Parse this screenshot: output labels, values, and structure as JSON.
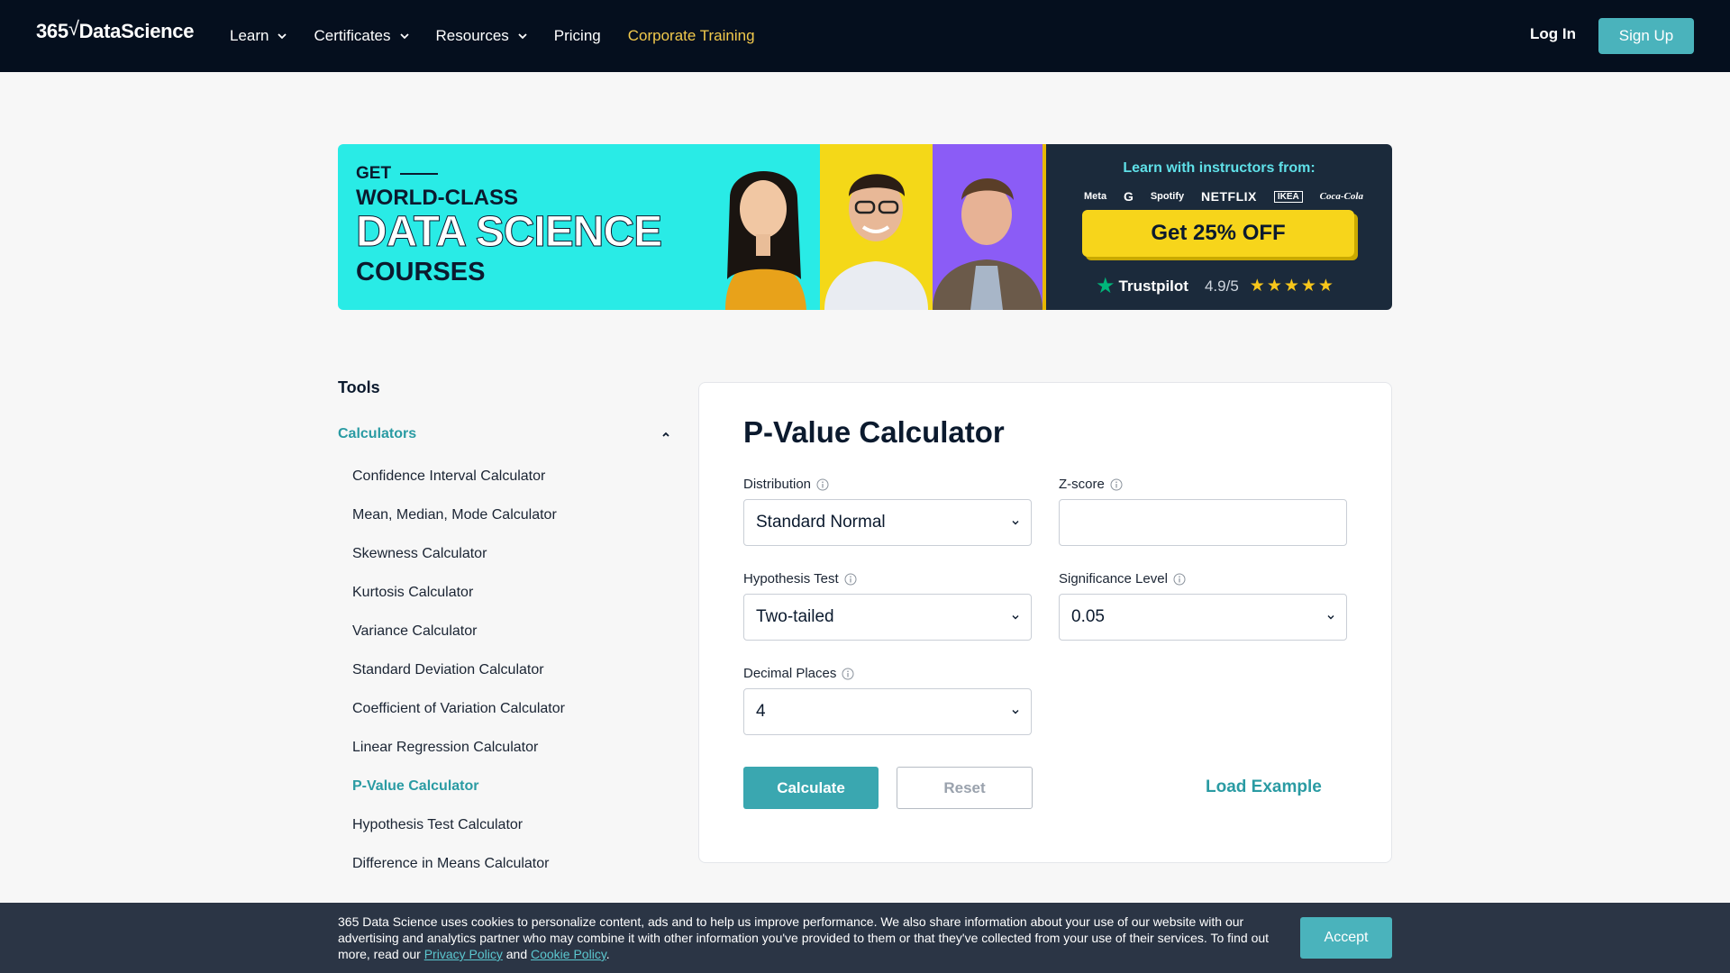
{
  "nav": {
    "logo_prefix": "365",
    "logo_check": "√",
    "logo_name": "DataScience",
    "items": [
      {
        "label": "Learn",
        "has_dropdown": true
      },
      {
        "label": "Certificates",
        "has_dropdown": true
      },
      {
        "label": "Resources",
        "has_dropdown": true
      },
      {
        "label": "Pricing",
        "has_dropdown": false
      },
      {
        "label": "Corporate Training",
        "has_dropdown": false,
        "color": "#f2c94c"
      }
    ],
    "login": "Log In",
    "signup": "Sign Up"
  },
  "banner": {
    "get": "GET",
    "world_class": "WORLD-CLASS",
    "data_science": "DATA SCIENCE",
    "courses": "COURSES",
    "learn_with": "Learn with instructors from:",
    "companies": [
      "Meta",
      "G",
      "Spotify",
      "NETFLIX",
      "IKEA",
      "Coca-Cola"
    ],
    "cta": "Get 25% OFF",
    "trustpilot": "Trustpilot",
    "rating": "4.9/5",
    "stars": 4.5
  },
  "sidebar": {
    "title": "Tools",
    "category": "Calculators",
    "items": [
      {
        "label": "Confidence Interval Calculator",
        "active": false
      },
      {
        "label": "Mean, Median, Mode Calculator",
        "active": false
      },
      {
        "label": "Skewness Calculator",
        "active": false
      },
      {
        "label": "Kurtosis Calculator",
        "active": false
      },
      {
        "label": "Variance Calculator",
        "active": false
      },
      {
        "label": "Standard Deviation Calculator",
        "active": false
      },
      {
        "label": "Coefficient of Variation Calculator",
        "active": false
      },
      {
        "label": "Linear Regression Calculator",
        "active": false
      },
      {
        "label": "P-Value Calculator",
        "active": true
      },
      {
        "label": "Hypothesis Test Calculator",
        "active": false
      },
      {
        "label": "Difference in Means Calculator",
        "active": false
      }
    ]
  },
  "calculator": {
    "title": "P-Value Calculator",
    "distribution": {
      "label": "Distribution",
      "value": "Standard Normal"
    },
    "zscore": {
      "label": "Z-score",
      "value": ""
    },
    "hypothesis": {
      "label": "Hypothesis Test",
      "value": "Two-tailed"
    },
    "significance": {
      "label": "Significance Level",
      "value": "0.05"
    },
    "decimals": {
      "label": "Decimal Places",
      "value": "4"
    },
    "calculate": "Calculate",
    "reset": "Reset",
    "load_example": "Load Example"
  },
  "cookie": {
    "text_1": "365 Data Science uses cookies to personalize content, ads and to help us improve performance. We also share information about your use of our website with our advertising and analytics partner who may combine it with other information you've provided to them or that they've collected from your use of their services. To find out more, read our ",
    "privacy": "Privacy Policy",
    "and": " and ",
    "cookie_policy": "Cookie Policy",
    "end": ".",
    "accept": "Accept"
  },
  "colors": {
    "nav_bg": "#050f1e",
    "accent": "#3aa7b0",
    "corporate": "#f2c94c",
    "banner_cyan": "#29ebe6",
    "banner_yellow": "#f4d818",
    "banner_purple": "#8b5cf6",
    "cta_yellow": "#f7d51b"
  }
}
